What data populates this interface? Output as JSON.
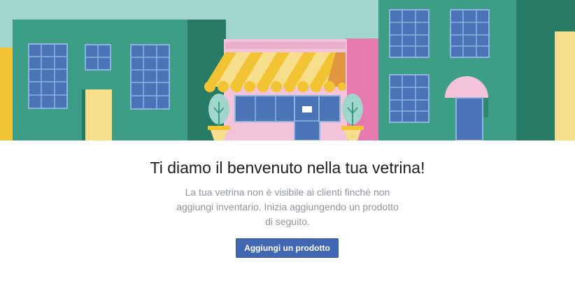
{
  "illustration": {
    "icon": "storefront-illustration",
    "colors": {
      "sky": "#a1d6cc",
      "building_green": "#3c9e86",
      "building_dark": "#277a63",
      "window_blue": "#4a73b8",
      "shop_pink": "#f3c3da",
      "awning_yellow": "#f2c433",
      "accent_yellow": "#f7de8c"
    }
  },
  "welcome": {
    "title": "Ti diamo il benvenuto nella tua vetrina!",
    "description": "La tua vetrina non è visibile ai clienti finché non aggiungi inventario. Inizia aggiungendo un prodotto di seguito.",
    "button_label": "Aggiungi un prodotto"
  },
  "theme": {
    "primary": "#4267b2",
    "title_color": "#1c1e21",
    "muted_text": "#90949c"
  }
}
